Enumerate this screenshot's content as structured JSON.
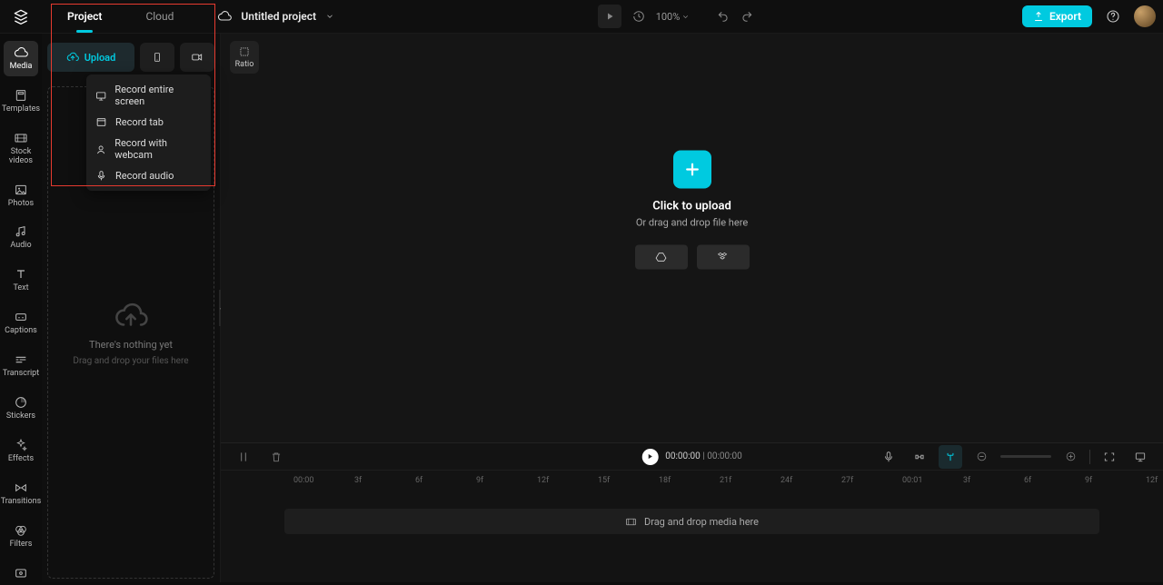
{
  "topbar": {
    "tabs": {
      "project": "Project",
      "cloud": "Cloud"
    },
    "project_title": "Untitled project",
    "zoom": "100%",
    "export": "Export"
  },
  "left_rail": [
    {
      "id": "media",
      "label": "Media"
    },
    {
      "id": "templates",
      "label": "Templates"
    },
    {
      "id": "stock-videos",
      "label": "Stock\nvideos"
    },
    {
      "id": "photos",
      "label": "Photos"
    },
    {
      "id": "audio",
      "label": "Audio"
    },
    {
      "id": "text",
      "label": "Text"
    },
    {
      "id": "captions",
      "label": "Captions"
    },
    {
      "id": "transcript",
      "label": "Transcript"
    },
    {
      "id": "stickers",
      "label": "Stickers"
    },
    {
      "id": "effects",
      "label": "Effects"
    },
    {
      "id": "transitions",
      "label": "Transitions"
    },
    {
      "id": "filters",
      "label": "Filters"
    }
  ],
  "side_panel": {
    "upload": "Upload",
    "empty_title": "There's nothing yet",
    "empty_sub": "Drag and drop your files here"
  },
  "record_menu": {
    "screen": "Record entire screen",
    "tab": "Record tab",
    "webcam": "Record with webcam",
    "audio": "Record audio"
  },
  "ratio": {
    "label": "Ratio"
  },
  "canvas": {
    "upload_title": "Click to upload",
    "upload_sub": "Or drag and drop file here"
  },
  "timeline": {
    "current": "00:00:00",
    "total": "00:00:00",
    "ruler": [
      "00:00",
      "3f",
      "6f",
      "9f",
      "12f",
      "15f",
      "18f",
      "21f",
      "24f",
      "27f",
      "00:01",
      "3f",
      "6f",
      "9f",
      "12f"
    ],
    "drop_label": "Drag and drop media here"
  }
}
